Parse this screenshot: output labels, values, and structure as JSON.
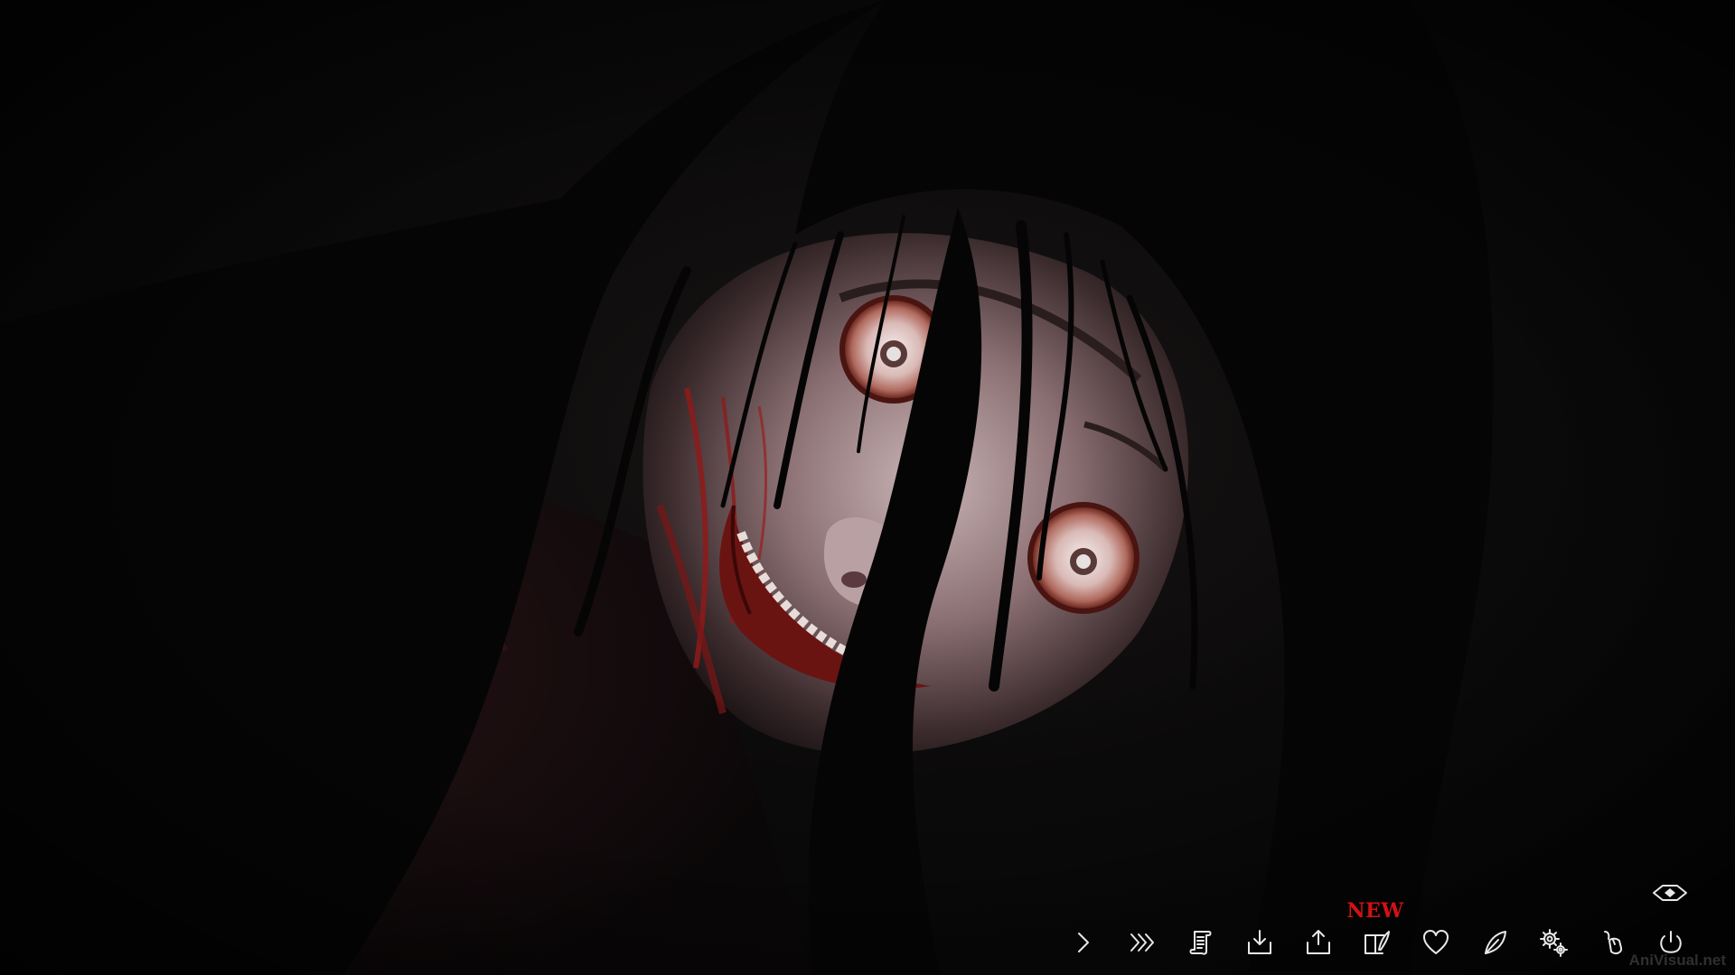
{
  "new_badge": "NEW",
  "watermark": "AniVisual.net",
  "colors": {
    "icon": "#e8e8e8",
    "badge": "#d21212",
    "background": "#070707"
  },
  "hide_ui_icon": "hide-ui-icon",
  "toolbar": [
    {
      "id": "next",
      "icon": "chevron-right-icon"
    },
    {
      "id": "skip",
      "icon": "double-chevron-right-icon"
    },
    {
      "id": "backlog",
      "icon": "scroll-icon"
    },
    {
      "id": "save",
      "icon": "download-tray-icon"
    },
    {
      "id": "load",
      "icon": "upload-tray-icon"
    },
    {
      "id": "extras",
      "icon": "book-quill-icon"
    },
    {
      "id": "favorite",
      "icon": "heart-icon"
    },
    {
      "id": "journal",
      "icon": "leaf-icon"
    },
    {
      "id": "settings",
      "icon": "gears-icon"
    },
    {
      "id": "mouse",
      "icon": "mouse-icon"
    },
    {
      "id": "quit",
      "icon": "power-icon"
    }
  ]
}
